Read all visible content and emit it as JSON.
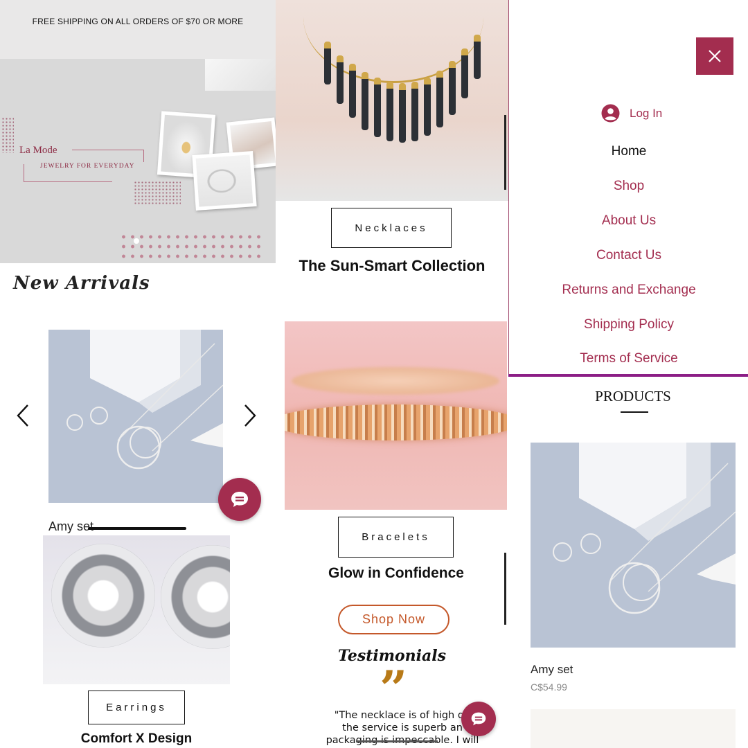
{
  "announcement": {
    "text": "FREE SHIPPING ON ALL ORDERS  OF $70 OR MORE"
  },
  "hero": {
    "brand": "La Mode",
    "tagline": "JEWELRY FOR EVERYDAY"
  },
  "new_arrivals": {
    "title": "New Arrivals",
    "featured": {
      "name": "Amy set"
    }
  },
  "categories": [
    {
      "button_label": "Necklaces",
      "collection": "The Sun-Smart Collection"
    },
    {
      "button_label": "Bracelets",
      "collection": "Glow in Confidence"
    },
    {
      "button_label": "Earrings",
      "collection": "Comfort X Design"
    }
  ],
  "cta": {
    "shop_now": "Shop Now"
  },
  "testimonials": {
    "title": "Testimonials",
    "quote_mark": "”",
    "quote": "\"The necklace is of high qu\nthe service is superb an\npackaging is impeccable.  I will"
  },
  "menu": {
    "login_label": "Log In",
    "items": [
      "Home",
      "Shop",
      "About Us",
      "Contact Us",
      "Returns and Exchange",
      "Shipping Policy",
      "Terms of Service"
    ]
  },
  "products": {
    "title": "PRODUCTS",
    "items": [
      {
        "name": "Amy set",
        "price": "C$54.99"
      }
    ]
  },
  "icons": {
    "close": "close-icon",
    "user": "user-icon",
    "chat": "chat-icon",
    "prev": "chevron-left-icon",
    "next": "chevron-right-icon"
  },
  "colors": {
    "brand": "#a32d4f",
    "accent_orange": "#c4582a",
    "quote_gold": "#b87a18",
    "menu_rule": "#8c1e86"
  }
}
